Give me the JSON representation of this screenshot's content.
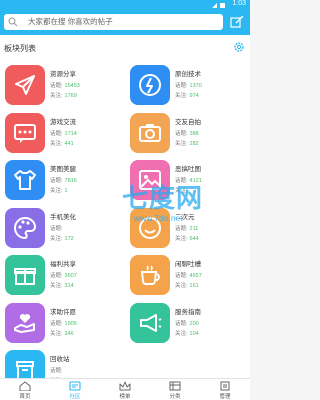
{
  "status": {
    "time": "1:03"
  },
  "search": {
    "placeholder": "大家都在搜 你喜欢的帖子"
  },
  "section": {
    "title": "板块列表"
  },
  "labels": {
    "topics": "话题:",
    "followers": "关注:"
  },
  "boards": [
    {
      "name": "资源分享",
      "topics": "15453",
      "followers": "1769",
      "icon": "paper-plane-icon",
      "color": "#f05c5c"
    },
    {
      "name": "原创技术",
      "topics": "1370",
      "followers": "974",
      "icon": "lightbulb-icon",
      "color": "#2f8ef3"
    },
    {
      "name": "游戏交流",
      "topics": "1714",
      "followers": "441",
      "icon": "chat-icon",
      "color": "#f05c5c"
    },
    {
      "name": "交友自拍",
      "topics": "388",
      "followers": "282",
      "icon": "camera-icon",
      "color": "#f4a553"
    },
    {
      "name": "美图美腿",
      "topics": "7816",
      "followers": "1",
      "icon": "tshirt-icon",
      "color": "#2f8ef3"
    },
    {
      "name": "恶搞吐图",
      "topics": "4121",
      "followers": "",
      "icon": "image-icon",
      "color": "#f06fb0"
    },
    {
      "name": "手机美化",
      "topics": "",
      "followers": "172",
      "icon": "palette-icon",
      "color": "#8a6ee8"
    },
    {
      "name": "二次元",
      "topics": "211",
      "followers": "644",
      "icon": "smiley-icon",
      "color": "#f5a34a"
    },
    {
      "name": "福利共享",
      "topics": "3607",
      "followers": "314",
      "icon": "gift-icon",
      "color": "#34c39a"
    },
    {
      "name": "闲聊吐槽",
      "topics": "4657",
      "followers": "161",
      "icon": "coffee-cup-icon",
      "color": "#f5a34a"
    },
    {
      "name": "求助许愿",
      "topics": "1905",
      "followers": "346",
      "icon": "heart-hand-icon",
      "color": "#b06de6"
    },
    {
      "name": "服务指南",
      "topics": "200",
      "followers": "104",
      "icon": "megaphone-icon",
      "color": "#34c39a"
    },
    {
      "name": "回收站",
      "topics": "",
      "followers": "",
      "icon": "trash-bin-icon",
      "color": "#2ab7f2"
    }
  ],
  "watermark": {
    "logo": "七度网",
    "url": "www.7do.net"
  },
  "nav": [
    {
      "label": "首页",
      "icon": "home-icon"
    },
    {
      "label": "社区",
      "icon": "community-icon",
      "active": true
    },
    {
      "label": "榜单",
      "icon": "crown-icon"
    },
    {
      "label": "分类",
      "icon": "category-icon"
    },
    {
      "label": "管理",
      "icon": "manage-icon"
    }
  ],
  "colors": {
    "header": "#2ab7f2",
    "count_green": "#49c06a"
  }
}
